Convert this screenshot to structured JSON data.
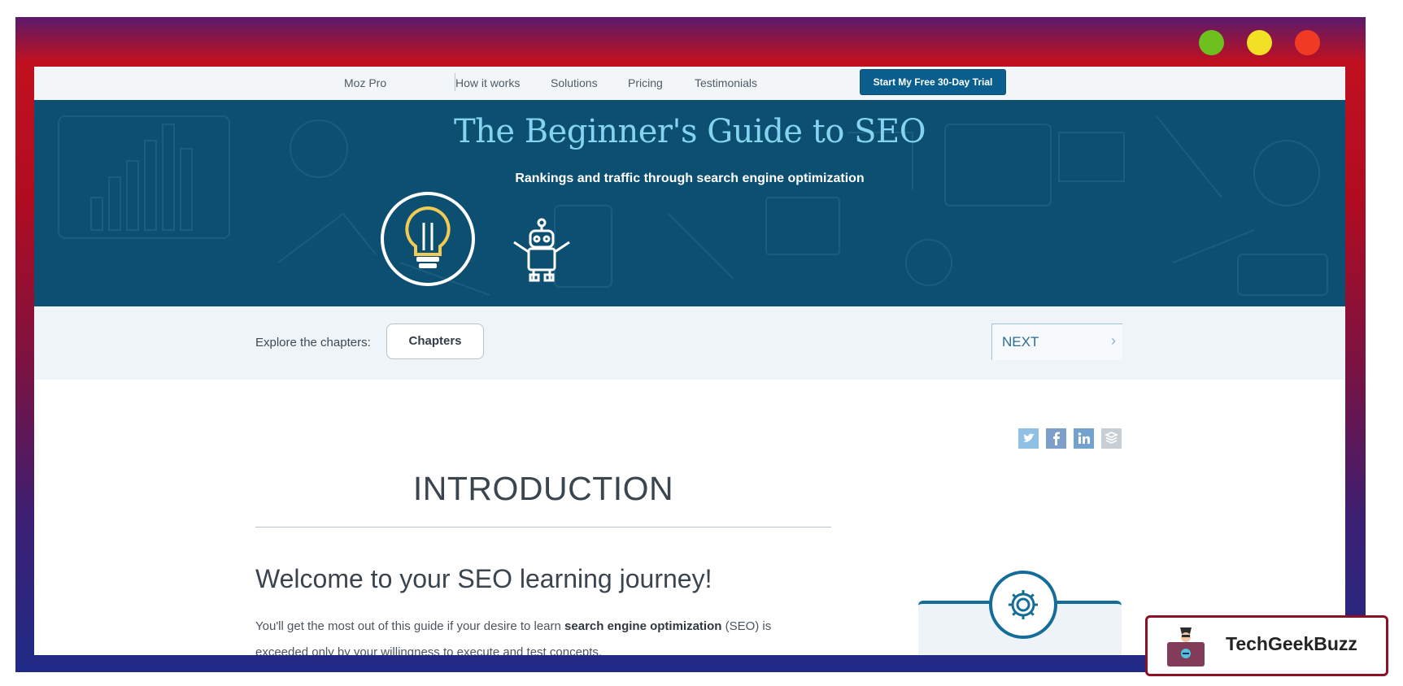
{
  "nav": {
    "brand": "Moz Pro",
    "links": [
      "How it works",
      "Solutions",
      "Pricing",
      "Testimonials"
    ],
    "cta": "Start My Free 30-Day Trial"
  },
  "hero": {
    "title": "The Beginner's Guide to SEO",
    "subtitle": "Rankings and traffic through search engine optimization"
  },
  "chapters": {
    "explore_label": "Explore the chapters:",
    "button": "Chapters",
    "next": "NEXT",
    "next_icon": "chevron-right-icon"
  },
  "share": {
    "icons": [
      "twitter-icon",
      "facebook-icon",
      "linkedin-icon",
      "buffer-icon"
    ]
  },
  "content": {
    "section_title": "INTRODUCTION",
    "heading": "Welcome to your SEO learning journey!",
    "intro_before": "You'll get the most out of this guide if your desire to learn ",
    "intro_bold": "search engine optimization",
    "intro_after": " (SEO) is exceeded only by your willingness to execute and test concepts."
  },
  "watermark": {
    "text": "TechGeekBuzz"
  },
  "colors": {
    "hero_bg": "#0c4f70",
    "hero_title": "#84d3ef",
    "accent": "#0a5f8f",
    "window_dot_green": "#6ec01e",
    "window_dot_yellow": "#f2e024",
    "window_dot_red": "#f03a24"
  }
}
